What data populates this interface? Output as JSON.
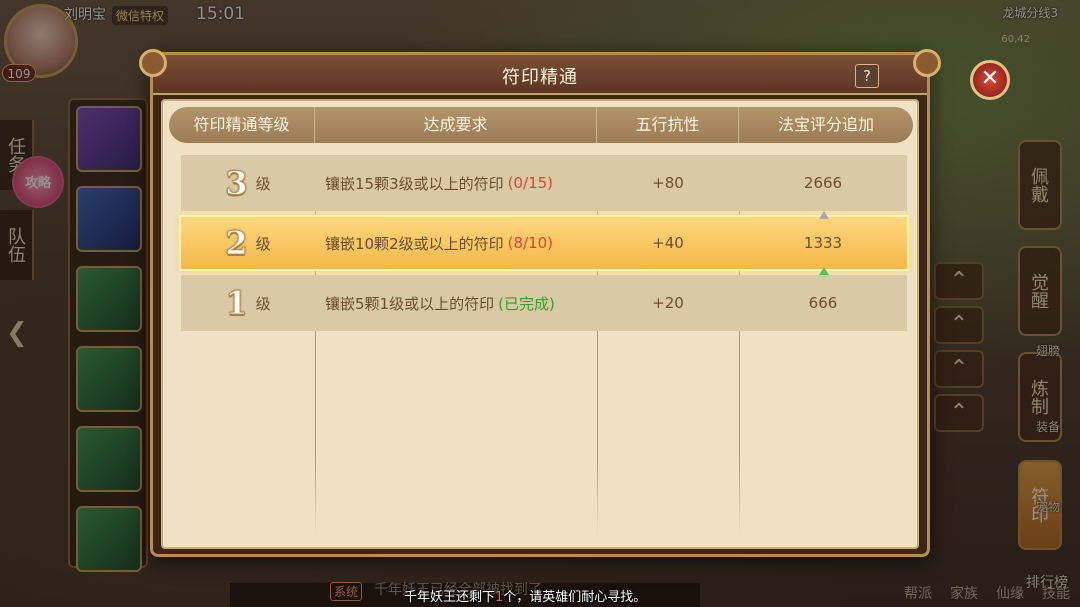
{
  "hud": {
    "player_name": "刘明宝",
    "vip_tag": "微信特权",
    "clock": "15:01",
    "level": "109",
    "server": "龙城分线3",
    "coords": "60,42"
  },
  "left_tabs": {
    "task": "任务",
    "team": "队伍",
    "guide": "攻略"
  },
  "right_menu": {
    "wear": "佩戴",
    "awaken": "觉醒",
    "refine": "炼制",
    "rune": "符印",
    "rank": "排行榜",
    "wing": "翅膀",
    "equip": "装备",
    "pet": "宠物"
  },
  "bottom": {
    "chat_system": "系统",
    "chat_message": "千年妖王已经全部被找到了",
    "tabs": [
      "帮派",
      "家族",
      "仙缘",
      "技能"
    ],
    "notice_pre": "千年妖王还剩下",
    "notice_num": "1",
    "notice_post": "个，请英雄们耐心寻找。"
  },
  "modal": {
    "title": "符印精通",
    "help": "?",
    "close": "✕",
    "headers": [
      "符印精通等级",
      "达成要求",
      "五行抗性",
      "法宝评分追加"
    ],
    "rows": [
      {
        "level": "3",
        "suffix": "级",
        "requirement": "镶嵌15颗3级或以上的符印",
        "progress": "(0/15)",
        "resist": "+80",
        "score": "2666"
      },
      {
        "level": "2",
        "suffix": "级",
        "requirement": "镶嵌10颗2级或以上的符印",
        "progress": "(8/10)",
        "resist": "+40",
        "score": "1333"
      },
      {
        "level": "1",
        "suffix": "级",
        "requirement": "镶嵌5颗1级或以上的符印",
        "progress": "(已完成)",
        "resist": "+20",
        "score": "666"
      }
    ]
  },
  "colors": {
    "highlight_row": "#f3b84a",
    "progress_incomplete": "#d9443a",
    "progress_complete": "#3d9a2e"
  }
}
